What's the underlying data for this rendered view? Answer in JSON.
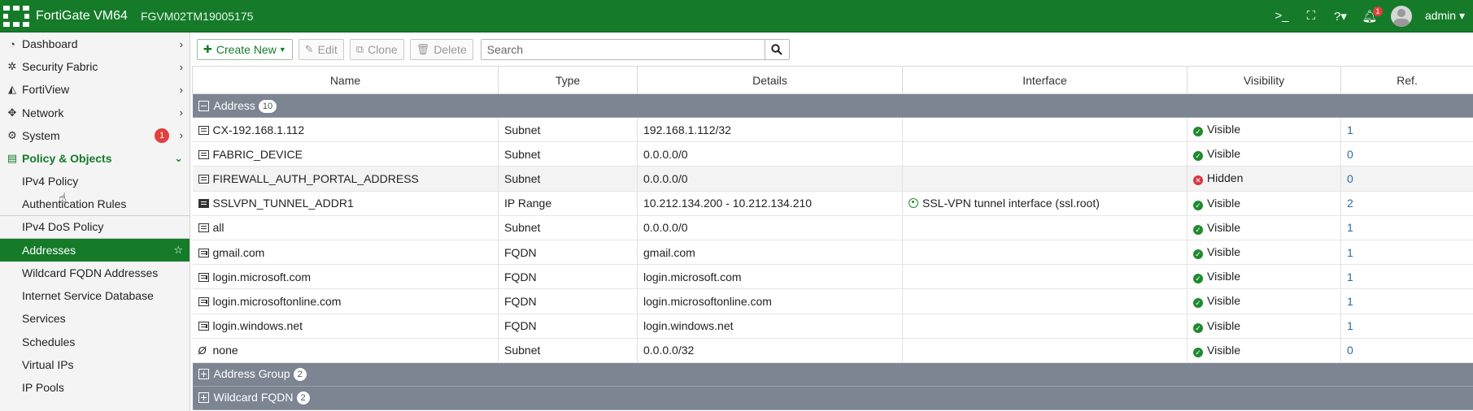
{
  "topbar": {
    "brand": "FortiGate VM64",
    "serial": "FGVM02TM19005175",
    "notification_count": "1",
    "user": "admin"
  },
  "sidebar": {
    "items": [
      {
        "label": "Dashboard",
        "icon": "dashboard-icon"
      },
      {
        "label": "Security Fabric",
        "icon": "security-fabric-icon"
      },
      {
        "label": "FortiView",
        "icon": "fortiview-icon"
      },
      {
        "label": "Network",
        "icon": "network-icon"
      },
      {
        "label": "System",
        "icon": "gear-icon",
        "badge": "1"
      },
      {
        "label": "Policy & Objects",
        "icon": "policy-icon"
      }
    ],
    "sub_items": [
      "IPv4 Policy",
      "Authentication Rules",
      "IPv4 DoS Policy",
      "Addresses",
      "Wildcard FQDN Addresses",
      "Internet Service Database",
      "Services",
      "Schedules",
      "Virtual IPs",
      "IP Pools"
    ]
  },
  "toolbar": {
    "create_new": "Create New",
    "edit": "Edit",
    "clone": "Clone",
    "delete": "Delete",
    "search_placeholder": "Search"
  },
  "table": {
    "columns": [
      "Name",
      "Type",
      "Details",
      "Interface",
      "Visibility",
      "Ref."
    ],
    "groups": [
      {
        "label": "Address",
        "count": "10",
        "expanded": true
      },
      {
        "label": "Address Group",
        "count": "2",
        "expanded": false
      },
      {
        "label": "Wildcard FQDN",
        "count": "2",
        "expanded": false
      }
    ],
    "rows": [
      {
        "name": "CX-192.168.1.112",
        "type": "Subnet",
        "details": "192.168.1.112/32",
        "interface": "",
        "visibility": "Visible",
        "ref": "1"
      },
      {
        "name": "FABRIC_DEVICE",
        "type": "Subnet",
        "details": "0.0.0.0/0",
        "interface": "",
        "visibility": "Visible",
        "ref": "0"
      },
      {
        "name": "FIREWALL_AUTH_PORTAL_ADDRESS",
        "type": "Subnet",
        "details": "0.0.0.0/0",
        "interface": "",
        "visibility": "Hidden",
        "ref": "0"
      },
      {
        "name": "SSLVPN_TUNNEL_ADDR1",
        "type": "IP Range",
        "details": "10.212.134.200 - 10.212.134.210",
        "interface": "SSL-VPN tunnel interface (ssl.root)",
        "visibility": "Visible",
        "ref": "2"
      },
      {
        "name": "all",
        "type": "Subnet",
        "details": "0.0.0.0/0",
        "interface": "",
        "visibility": "Visible",
        "ref": "1"
      },
      {
        "name": "gmail.com",
        "type": "FQDN",
        "details": "gmail.com",
        "interface": "",
        "visibility": "Visible",
        "ref": "1"
      },
      {
        "name": "login.microsoft.com",
        "type": "FQDN",
        "details": "login.microsoft.com",
        "interface": "",
        "visibility": "Visible",
        "ref": "1"
      },
      {
        "name": "login.microsoftonline.com",
        "type": "FQDN",
        "details": "login.microsoftonline.com",
        "interface": "",
        "visibility": "Visible",
        "ref": "1"
      },
      {
        "name": "login.windows.net",
        "type": "FQDN",
        "details": "login.windows.net",
        "interface": "",
        "visibility": "Visible",
        "ref": "1"
      },
      {
        "name": "none",
        "type": "Subnet",
        "details": "0.0.0.0/32",
        "interface": "",
        "visibility": "Visible",
        "ref": "0"
      }
    ]
  },
  "colors": {
    "brand_green": "#157b29",
    "group_row": "#7d8593",
    "visible_green": "#1f8a2e",
    "hidden_red": "#d9363e",
    "link_blue": "#2a6aa8"
  }
}
